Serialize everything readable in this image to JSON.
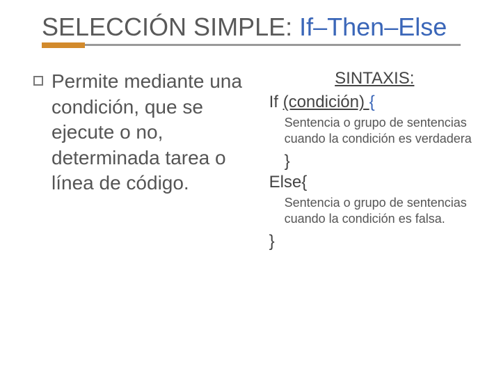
{
  "title": {
    "part1": "SELECCIÓN SIMPLE: ",
    "part2": "If–Then–Else"
  },
  "left": {
    "text": "Permite mediante una condición, que se ejecute o no, determinada tarea o línea de código."
  },
  "right": {
    "syntax_label": "SINTAXIS:",
    "if_word": "If ",
    "condition": "(condición) ",
    "open_brace": "{",
    "true_text": "Sentencia o grupo de sentencias cuando la condición es verdadera",
    "close_brace1": "}",
    "else_line": "Else{",
    "false_text": "Sentencia o grupo de sentencias cuando la condición es falsa.",
    "close_brace2": "}"
  }
}
